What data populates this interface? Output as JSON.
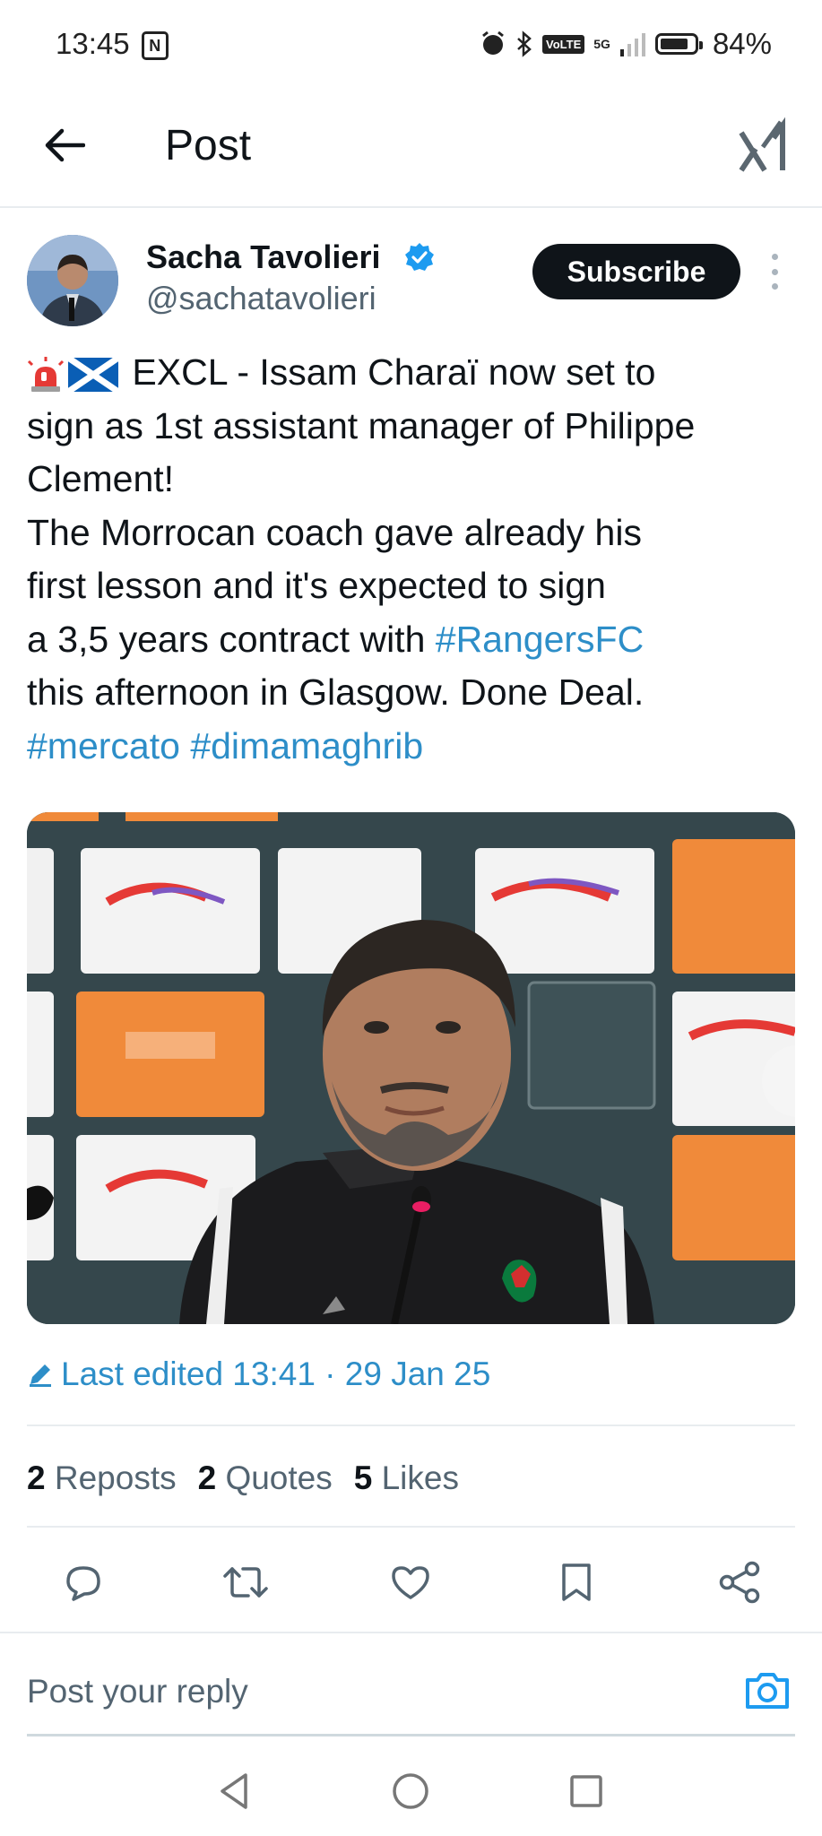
{
  "status": {
    "time": "13:45",
    "volte": "VoLTE",
    "network": "5G",
    "battery": "84%"
  },
  "header": {
    "title": "Post"
  },
  "author": {
    "name": "Sacha Tavolieri",
    "handle": "@sachatavolieri",
    "subscribe_label": "Subscribe"
  },
  "post": {
    "lines": [
      {
        "text": " EXCL - Issam Charaï now set to"
      },
      {
        "text": "sign as 1st assistant manager of Philippe"
      },
      {
        "text": "Clement!"
      },
      {
        "text": "The Morrocan coach gave already his"
      },
      {
        "text": "first lesson and it's expected to sign"
      },
      {
        "text": "a 3,5 years contract with ",
        "tag": "#RangersFC"
      },
      {
        "text": "this afternoon in Glasgow. Done Deal."
      },
      {
        "tag1": "#mercato",
        "tag2": "#dimamaghrib"
      }
    ],
    "emojis": [
      "police-light-emoji",
      "scotland-flag-emoji"
    ]
  },
  "edited": {
    "label": "Last edited 13:41 · 29 Jan 25"
  },
  "stats": {
    "reposts_count": "2",
    "reposts_label": "Reposts",
    "quotes_count": "2",
    "quotes_label": "Quotes",
    "likes_count": "5",
    "likes_label": "Likes"
  },
  "reply": {
    "placeholder": "Post your reply"
  },
  "icons": {
    "back": "arrow-left-icon",
    "brand": "x-logo-icon",
    "verified": "verified-badge-icon",
    "reply": "comment-icon",
    "repost": "repost-icon",
    "like": "heart-icon",
    "bookmark": "bookmark-icon",
    "share": "share-icon",
    "camera": "camera-icon"
  },
  "colors": {
    "link": "#2d8ec8",
    "text": "#0f1419",
    "muted": "#536471",
    "verified": "#1d9bf0"
  }
}
